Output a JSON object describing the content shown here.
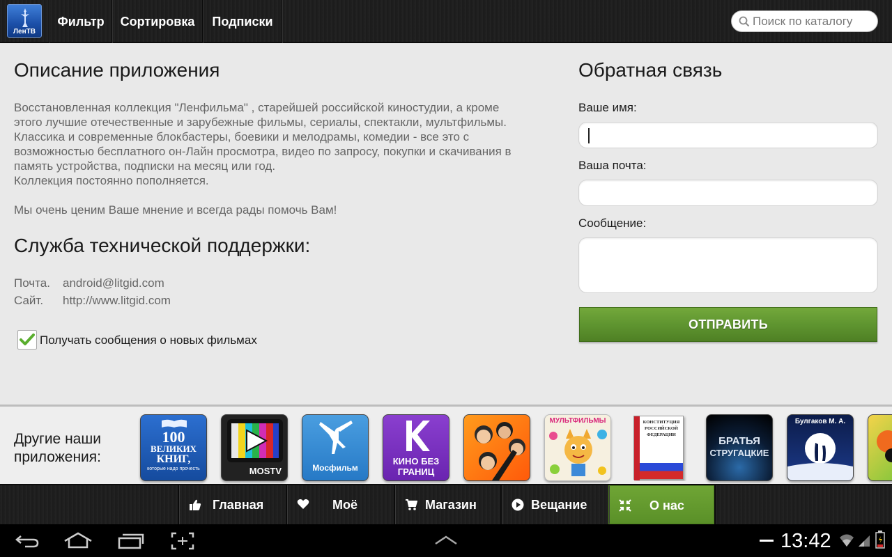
{
  "header": {
    "app_logo_text": "ЛенТВ",
    "tabs": [
      {
        "label": "Фильтр"
      },
      {
        "label": "Сортировка"
      },
      {
        "label": "Подписки"
      }
    ],
    "search_placeholder": "Поиск по каталогу"
  },
  "about": {
    "title": "Описание приложения",
    "description_lines": [
      "Восстановленная коллекция \"Ленфильма\" , старейшей российской киностудии, а кроме",
      "этого лучшие отечественные и зарубежные фильмы, сериалы, спектакли, мультфильмы.",
      "Классика и современные блокбастеры, боевики и мелодрамы, комедии - все это с",
      "возможностью бесплатного он-Лайн просмотра, видео по запросу, покупки и скачивания в",
      "память устройства, подписки на месяц или год.",
      "Коллекция постоянно пополняется."
    ],
    "closing_line": "Мы очень ценим Ваше мнение и всегда рады помочь Вам!"
  },
  "support": {
    "title": "Служба технической поддержки:",
    "email_label": "Почта.",
    "email_value": "android@litgid.com",
    "site_label": "Сайт.",
    "site_value": "http://www.litgid.com"
  },
  "subscribe": {
    "label": "Получать сообщения о новых фильмах",
    "checked": true
  },
  "feedback": {
    "title": "Обратная связь",
    "name_label": "Ваше имя:",
    "name_value": "",
    "email_label": "Ваша почта:",
    "email_value": "",
    "message_label": "Сообщение:",
    "message_value": "",
    "submit_label": "ОТПРАВИТЬ"
  },
  "other_apps": {
    "label": "Другие наши приложения:",
    "apps": [
      {
        "name": "100 великих книг",
        "line1": "100",
        "line2": "ВЕЛИКИХ",
        "line3": "КНИГ,",
        "line4": "которые надо прочесть"
      },
      {
        "name": "MosTV",
        "caption": "MOSTV"
      },
      {
        "name": "Мосфильм",
        "caption": "Мосфильм"
      },
      {
        "name": "Кино без границ",
        "caption_line1": "КИНО БЕЗ",
        "caption_line2": "ГРАНИЦ"
      },
      {
        "name": "Комедии"
      },
      {
        "name": "Мультфильмы",
        "caption": "МУЛЬТФИЛЬМЫ"
      },
      {
        "name": "Конституция РФ",
        "caption_line1": "КОНСТИТУЦИЯ",
        "caption_line2": "РОССИЙСКОЙ",
        "caption_line3": "ФЕДЕРАЦИИ"
      },
      {
        "name": "Братья Стругацкие",
        "caption_line1": "БРАТЬЯ",
        "caption_line2": "СТРУГАЦКИЕ"
      },
      {
        "name": "Булгаков М. А.",
        "caption": "Булгаков М. А."
      },
      {
        "name": "partial app"
      }
    ]
  },
  "bottom_nav": {
    "items": [
      {
        "label": "Главная",
        "icon": "thumbs-up-icon",
        "active": false
      },
      {
        "label": "Моё",
        "icon": "heart-icon",
        "active": false
      },
      {
        "label": "Магазин",
        "icon": "cart-icon",
        "active": false
      },
      {
        "label": "Вещание",
        "icon": "play-icon",
        "active": false
      },
      {
        "label": "О нас",
        "icon": "shrink-arrows-icon",
        "active": true
      }
    ]
  },
  "system_bar": {
    "time": "13:42"
  },
  "colors": {
    "accent_green": "#5f9530",
    "bar_dark": "#1f1f1f",
    "content_bg": "#e9e9e9"
  }
}
